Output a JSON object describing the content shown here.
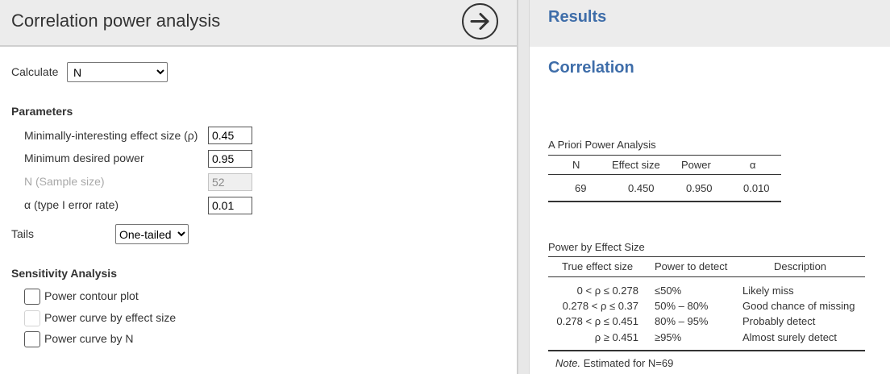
{
  "left": {
    "title": "Correlation power analysis",
    "calculate": {
      "label": "Calculate",
      "selected": "N"
    },
    "parameters": {
      "heading": "Parameters",
      "fields": [
        {
          "label": "Minimally-interesting effect size (ρ)",
          "value": "0.45",
          "enabled": true
        },
        {
          "label": "Minimum desired power",
          "value": "0.95",
          "enabled": true
        },
        {
          "label": "N (Sample size)",
          "value": "52",
          "enabled": false
        },
        {
          "label": "α (type I error rate)",
          "value": "0.01",
          "enabled": true
        }
      ]
    },
    "tails": {
      "label": "Tails",
      "selected": "One-tailed"
    },
    "sensitivity": {
      "heading": "Sensitivity Analysis",
      "options": [
        {
          "label": "Power contour plot",
          "checked": false,
          "enabled": true
        },
        {
          "label": "Power curve by effect size",
          "checked": false,
          "enabled": false
        },
        {
          "label": "Power curve by N",
          "checked": false,
          "enabled": true
        }
      ]
    }
  },
  "right": {
    "header": "Results",
    "analysis_title": "Correlation",
    "apriori": {
      "caption": "A Priori Power Analysis",
      "columns": [
        "N",
        "Effect size",
        "Power",
        "α"
      ],
      "row": [
        "69",
        "0.450",
        "0.950",
        "0.010"
      ]
    },
    "power_by_effect": {
      "caption": "Power by Effect Size",
      "columns": [
        "True effect size",
        "Power to detect",
        "Description"
      ],
      "rows": [
        [
          "0 < ρ ≤ 0.278",
          "≤50%",
          "Likely miss"
        ],
        [
          "0.278 < ρ ≤ 0.37",
          "50% – 80%",
          "Good chance of missing"
        ],
        [
          "0.278 < ρ ≤ 0.451",
          "80% – 95%",
          "Probably detect"
        ],
        [
          "ρ ≥ 0.451",
          "≥95%",
          "Almost surely detect"
        ]
      ],
      "note_label": "Note.",
      "note_text": "Estimated for N=69"
    }
  },
  "colors": {
    "accent": "#3e6da9",
    "header_bg": "#ececec"
  },
  "icons": {
    "run": "arrow-circle-right-icon"
  }
}
